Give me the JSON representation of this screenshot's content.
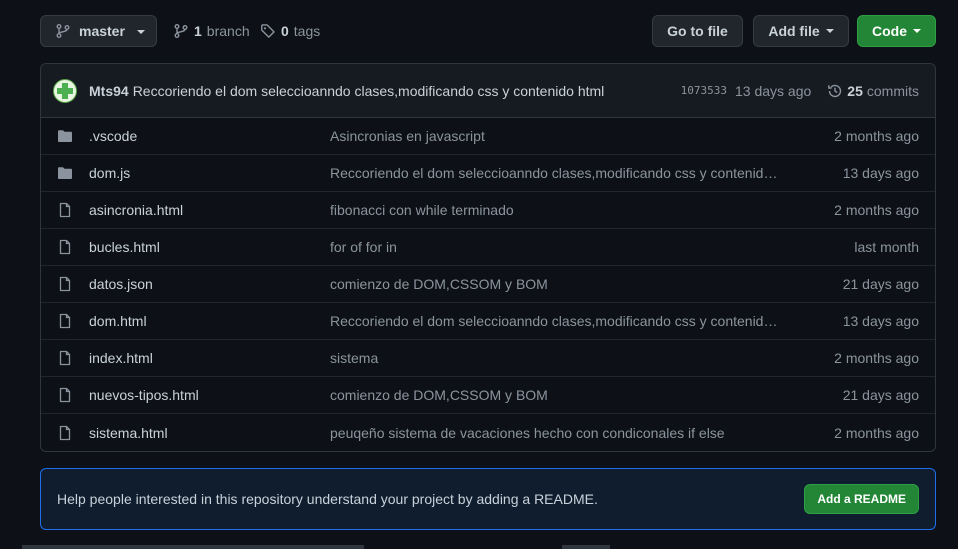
{
  "toolbar": {
    "branch_name": "master",
    "branch_count": "1",
    "branch_label": "branch",
    "tag_count": "0",
    "tag_label": "tags",
    "goto_file": "Go to file",
    "add_file": "Add file",
    "code": "Code"
  },
  "commit": {
    "author": "Mts94",
    "message": "Reccoriendo el dom seleccioanndo clases,modificando css y contenido html",
    "sha": "1073533",
    "time": "13 days ago",
    "commit_count": "25",
    "commit_label": "commits"
  },
  "files": [
    {
      "name": ".vscode",
      "type": "folder",
      "message": "Asincronias en javascript",
      "age": "2 months ago"
    },
    {
      "name": "dom.js",
      "type": "folder",
      "message": "Reccoriendo el dom seleccioanndo clases,modificando css y contenido …",
      "age": "13 days ago"
    },
    {
      "name": "asincronia.html",
      "type": "file",
      "message": "fibonacci con while terminado",
      "age": "2 months ago"
    },
    {
      "name": "bucles.html",
      "type": "file",
      "message": "for of for in",
      "age": "last month"
    },
    {
      "name": "datos.json",
      "type": "file",
      "message": "comienzo de DOM,CSSOM y BOM",
      "age": "21 days ago"
    },
    {
      "name": "dom.html",
      "type": "file",
      "message": "Reccoriendo el dom seleccioanndo clases,modificando css y contenido …",
      "age": "13 days ago"
    },
    {
      "name": "index.html",
      "type": "file",
      "message": "sistema",
      "age": "2 months ago"
    },
    {
      "name": "nuevos-tipos.html",
      "type": "file",
      "message": "comienzo de DOM,CSSOM y BOM",
      "age": "21 days ago"
    },
    {
      "name": "sistema.html",
      "type": "file",
      "message": "peuqeño sistema de vacaciones hecho con condiconales if else",
      "age": "2 months ago"
    }
  ],
  "readme": {
    "text": "Help people interested in this repository understand your project by adding a README.",
    "button": "Add a README"
  },
  "colors": {
    "background": "#0d1117",
    "accent_green": "#238636",
    "readme_border": "#1f6feb",
    "muted_text": "#8b949e"
  }
}
